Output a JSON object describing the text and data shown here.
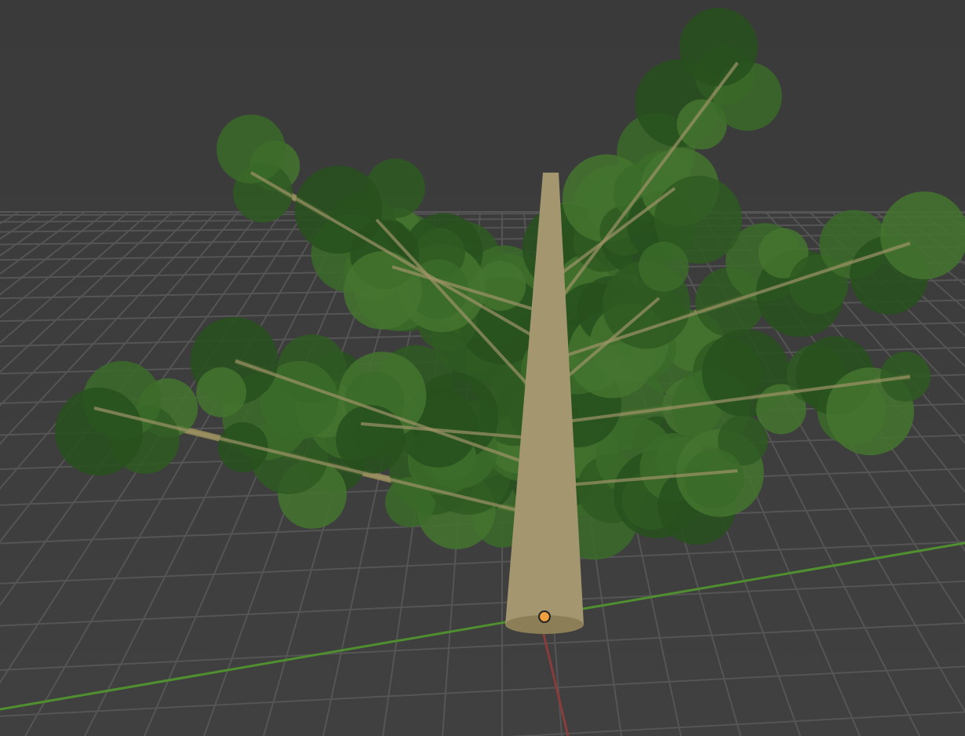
{
  "viewport": {
    "show_grid": true,
    "show_axes": true,
    "show_origin": true
  }
}
